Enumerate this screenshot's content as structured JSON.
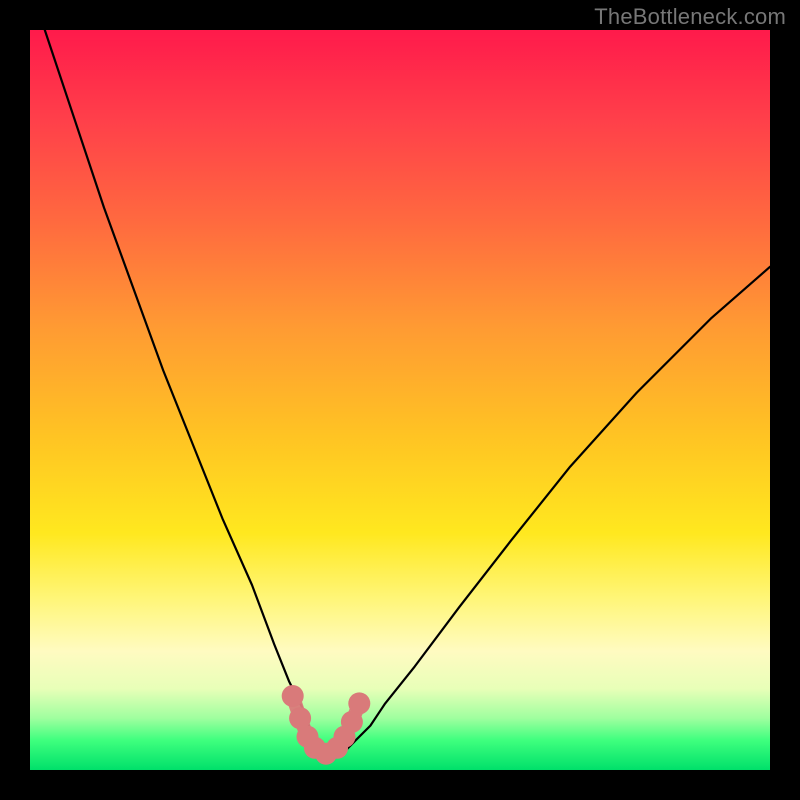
{
  "watermark": "TheBottleneck.com",
  "chart_data": {
    "type": "line",
    "title": "",
    "xlabel": "",
    "ylabel": "",
    "xlim": [
      0,
      100
    ],
    "ylim": [
      0,
      100
    ],
    "series": [
      {
        "name": "bottleneck-curve",
        "x": [
          2,
          6,
          10,
          14,
          18,
          22,
          26,
          30,
          33,
          35,
          37,
          38,
          39,
          40,
          41,
          42,
          43,
          44,
          46,
          48,
          52,
          58,
          65,
          73,
          82,
          92,
          100
        ],
        "y": [
          100,
          88,
          76,
          65,
          54,
          44,
          34,
          25,
          17,
          12,
          8,
          5,
          3,
          2,
          2,
          2,
          3,
          4,
          6,
          9,
          14,
          22,
          31,
          41,
          51,
          61,
          68
        ]
      }
    ],
    "highlight_points": {
      "name": "optimal-region",
      "x": [
        35.5,
        36.5,
        37.5,
        38.5,
        40,
        41.5,
        42.5,
        43.5,
        44.5
      ],
      "y": [
        10,
        7,
        4.5,
        3,
        2.2,
        3,
        4.5,
        6.5,
        9
      ]
    },
    "colors": {
      "curve": "#000000",
      "highlight": "#d97a7a"
    }
  }
}
